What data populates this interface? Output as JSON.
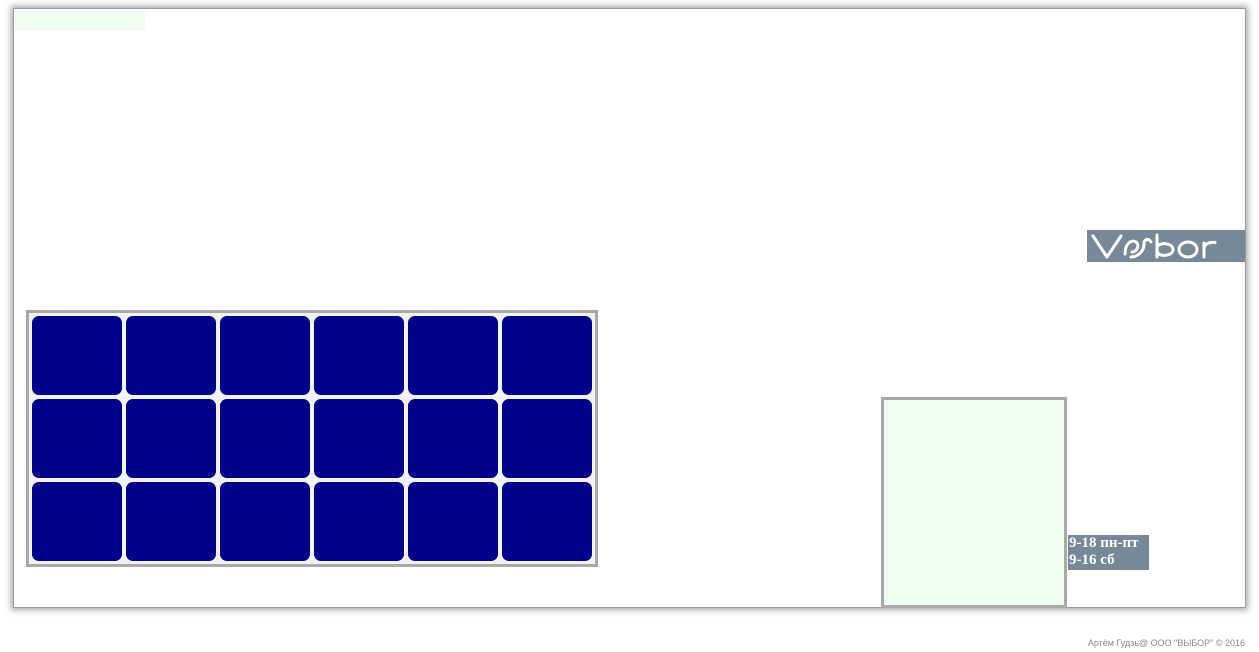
{
  "logo": {
    "text": "vybor",
    "background": "#778899",
    "color": "#ffffff"
  },
  "grid": {
    "rows": 3,
    "columns": 6,
    "tile_color": "#00008b",
    "border_color": "#a9a9a9"
  },
  "side_panel": {
    "background": "#effdf0"
  },
  "hours": {
    "weekdays": "9-18 пн-пт",
    "saturday": "9-16 сб",
    "background": "#778899"
  },
  "footer": {
    "text": "Артём Гудзь@ ООО \"ВЫБОР\" © 2016"
  }
}
